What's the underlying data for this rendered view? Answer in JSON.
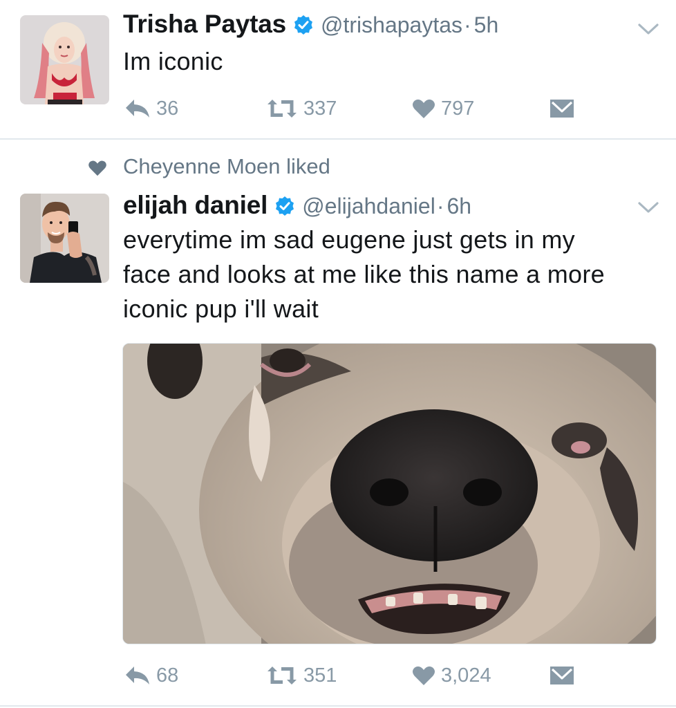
{
  "tweets": [
    {
      "name": "Trisha Paytas",
      "handle": "@trishapaytas",
      "separator": "·",
      "time": "5h",
      "text": "Im iconic",
      "replies": "36",
      "retweets": "337",
      "likes": "797",
      "avatar_icon": "profile-photo"
    },
    {
      "social_context": "Cheyenne Moen liked",
      "name": "elijah daniel",
      "handle": "@elijahdaniel",
      "separator": "·",
      "time": "6h",
      "text_lines": [
        "everytime im sad eugene just gets in my",
        "face and looks at me like this name a more",
        "iconic pup i'll wait"
      ],
      "replies": "68",
      "retweets": "351",
      "likes": "3,024",
      "media_icon": "bulldog-photo"
    }
  ],
  "colors": {
    "verified": "#1da1f2",
    "muted": "#8899a6",
    "secondary": "#657786",
    "text": "#14171a",
    "divider": "#e1e8ed"
  },
  "icons": [
    "reply-icon",
    "retweet-icon",
    "like-icon",
    "dm-icon",
    "chevron-down-icon",
    "verified-icon",
    "heart-icon"
  ]
}
